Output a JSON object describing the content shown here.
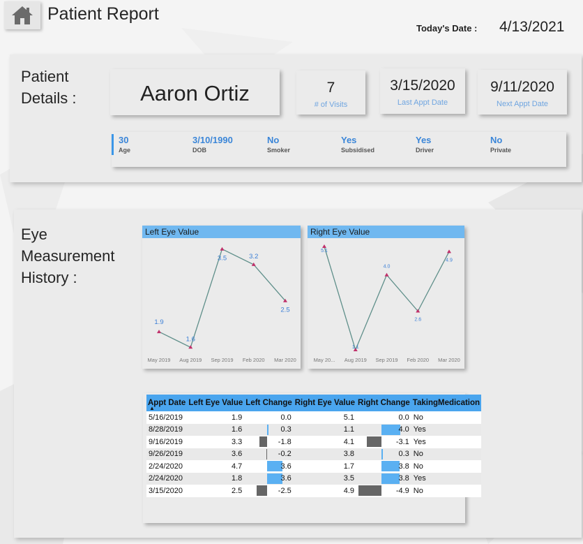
{
  "header": {
    "title": "Patient Report",
    "date_label": "Today's Date :",
    "date_value": "4/13/2021"
  },
  "details": {
    "title": "Patient Details :",
    "name": "Aaron Ortiz",
    "visits": {
      "value": "7",
      "label": "# of Visits"
    },
    "last_appt": {
      "value": "3/15/2020",
      "label": "Last Appt Date"
    },
    "next_appt": {
      "value": "9/11/2020",
      "label": "Next Appt Date"
    },
    "attributes": [
      {
        "value": "30",
        "label": "Age"
      },
      {
        "value": "3/10/1990",
        "label": "DOB"
      },
      {
        "value": "No",
        "label": "Smoker"
      },
      {
        "value": "Yes",
        "label": "Subsidised"
      },
      {
        "value": "Yes",
        "label": "Driver"
      },
      {
        "value": "No",
        "label": "Private"
      }
    ]
  },
  "eye": {
    "title": "Eye Measurement History :"
  },
  "colors": {
    "accent_blue": "#4aa5ee",
    "chart_header": "#70b8f0",
    "line": "#5f8f8a",
    "marker": "#c0306a",
    "positive_bar": "#5ab0f2",
    "negative_bar": "#666666"
  },
  "chart_data": [
    {
      "type": "line",
      "title": "Left Eye Value",
      "categories": [
        "May 2019",
        "Aug 2019",
        "Sep 2019",
        "Feb 2020",
        "Mar 2020"
      ],
      "values": [
        1.9,
        1.6,
        3.5,
        3.2,
        2.5
      ],
      "labels": [
        "1.9",
        "1.6",
        "3.5",
        "3.2",
        "2.5"
      ],
      "ylim": [
        1.55,
        3.55
      ]
    },
    {
      "type": "line",
      "title": "Right Eye Value",
      "categories": [
        "May 20...",
        "Aug 2019",
        "Sep 2019",
        "Feb 2020",
        "Mar 2020"
      ],
      "values": [
        5.1,
        1.1,
        4.0,
        2.6,
        4.9
      ],
      "labels": [
        "5.1",
        "1.1",
        "4.0",
        "2.6",
        "4.9"
      ],
      "ylim": [
        1.1,
        5.1
      ]
    }
  ],
  "table": {
    "columns": [
      "Appt Date",
      "Left Eye Value",
      "Left Change",
      "Right Eye Value",
      "Right Change",
      "TakingMedication"
    ],
    "rows": [
      {
        "date": "5/16/2019",
        "left": "1.9",
        "left_change": "0.0",
        "left_change_num": 0.0,
        "right": "5.1",
        "right_change": "0.0",
        "right_change_num": 0.0,
        "med": "No"
      },
      {
        "date": "8/28/2019",
        "left": "1.6",
        "left_change": "0.3",
        "left_change_num": 0.3,
        "right": "1.1",
        "right_change": "4.0",
        "right_change_num": 4.0,
        "med": "Yes"
      },
      {
        "date": "9/16/2019",
        "left": "3.3",
        "left_change": "-1.8",
        "left_change_num": -1.8,
        "right": "4.1",
        "right_change": "-3.1",
        "right_change_num": -3.1,
        "med": "Yes"
      },
      {
        "date": "9/26/2019",
        "left": "3.6",
        "left_change": "-0.2",
        "left_change_num": -0.2,
        "right": "3.8",
        "right_change": "0.3",
        "right_change_num": 0.3,
        "med": "No"
      },
      {
        "date": "2/24/2020",
        "left": "4.7",
        "left_change": "3.6",
        "left_change_num": 3.6,
        "right": "1.7",
        "right_change": "3.8",
        "right_change_num": 3.8,
        "med": "No"
      },
      {
        "date": "2/24/2020",
        "left": "1.8",
        "left_change": "3.6",
        "left_change_num": 3.6,
        "right": "3.5",
        "right_change": "3.8",
        "right_change_num": 3.8,
        "med": "Yes"
      },
      {
        "date": "3/15/2020",
        "left": "2.5",
        "left_change": "-2.5",
        "left_change_num": -2.5,
        "right": "4.9",
        "right_change": "-4.9",
        "right_change_num": -4.9,
        "med": "No"
      }
    ]
  }
}
